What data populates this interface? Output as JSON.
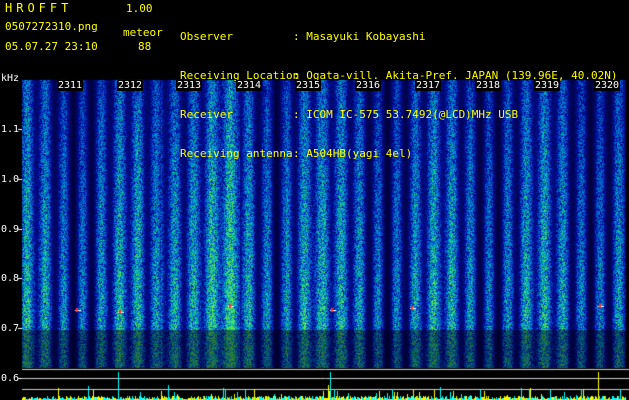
{
  "header": {
    "title": "HROFFT",
    "version": "1.00",
    "filename": "0507272310.png",
    "type": "meteor",
    "datetime": "05.07.27 23:10",
    "count": "88"
  },
  "meta": [
    {
      "key": "Observer",
      "value": ": Masayuki Kobayashi"
    },
    {
      "key": "Receiving Location",
      "value": ": Ogata-vill. Akita-Pref. JAPAN (139.96E, 40.02N)"
    },
    {
      "key": "Receiver",
      "value": ": ICOM IC-575 53.7492(@LCD)MHz USB"
    },
    {
      "key": "Receiving antenna",
      "value": ": A504HB(yagi 4el)"
    }
  ],
  "axis": {
    "unit": "kHz",
    "y_ticks": [
      "1.1",
      "1.0",
      "0.9",
      "0.8",
      "0.7",
      "0.6"
    ],
    "x_ticks": [
      "2311",
      "2312",
      "2313",
      "2314",
      "2315",
      "2316",
      "2317",
      "2318",
      "2319",
      "2320"
    ]
  },
  "colors": {
    "background": "#000000",
    "header_text": "#ffff00",
    "axis_text": "#ffffff"
  }
}
